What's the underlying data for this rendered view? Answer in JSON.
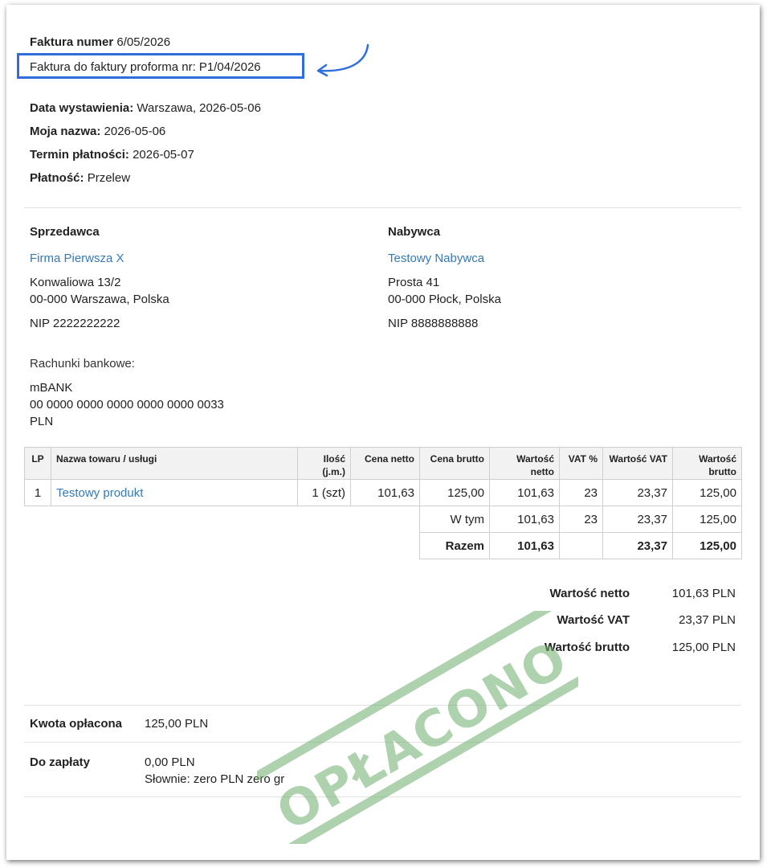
{
  "invoice": {
    "number_label": "Faktura numer",
    "number_value": "6/05/2026",
    "proforma_ref": "Faktura do faktury proforma nr: P1/04/2026"
  },
  "meta": [
    {
      "label": "Data wystawienia:",
      "value": "Warszawa, 2026-05-06"
    },
    {
      "label": "Moja nazwa:",
      "value": "2026-05-06"
    },
    {
      "label": "Termin płatności:",
      "value": "2026-05-07"
    },
    {
      "label": "Płatność:",
      "value": "Przelew"
    }
  ],
  "seller": {
    "heading": "Sprzedawca",
    "name": "Firma Pierwsza X",
    "street": "Konwaliowa 13/2",
    "city": "00-000 Warszawa, Polska",
    "nip": "NIP 2222222222"
  },
  "buyer": {
    "heading": "Nabywca",
    "name": "Testowy Nabywca",
    "street": "Prosta 41",
    "city": "00-000 Płock, Polska",
    "nip": "NIP 8888888888"
  },
  "bank": {
    "heading": "Rachunki bankowe:",
    "name": "mBANK",
    "account": "00 0000 0000 0000 0000 0000 0033",
    "currency": "PLN"
  },
  "items_table": {
    "headers": [
      "LP",
      "Nazwa towaru / usługi",
      "Ilość (j.m.)",
      "Cena netto",
      "Cena brutto",
      "Wartość netto",
      "VAT %",
      "Wartość VAT",
      "Wartość brutto"
    ],
    "header_lines": {
      "qty": [
        "Ilość",
        "(j.m.)"
      ],
      "net_value": [
        "Wartość",
        "netto"
      ],
      "gross_value": [
        "Wartość",
        "brutto"
      ]
    },
    "rows": [
      {
        "lp": "1",
        "name": "Testowy produkt",
        "qty": "1 (szt)",
        "net_price": "101,63",
        "gross_price": "125,00",
        "net_value": "101,63",
        "vat_rate": "23",
        "vat_value": "23,37",
        "gross_value": "125,00"
      }
    ],
    "subtotal": {
      "label": "W tym",
      "net_value": "101,63",
      "vat_rate": "23",
      "vat_value": "23,37",
      "gross_value": "125,00"
    },
    "total": {
      "label": "Razem",
      "net_value": "101,63",
      "vat_rate": "",
      "vat_value": "23,37",
      "gross_value": "125,00"
    }
  },
  "summary": [
    {
      "label": "Wartość netto",
      "value": "101,63 PLN"
    },
    {
      "label": "Wartość VAT",
      "value": "23,37 PLN"
    },
    {
      "label": "Wartość brutto",
      "value": "125,00 PLN"
    }
  ],
  "payment": {
    "paid_label": "Kwota opłacona",
    "paid_value": "125,00 PLN",
    "due_label": "Do zapłaty",
    "due_value": "0,00 PLN",
    "in_words": "Słownie: zero PLN zero gr"
  },
  "stamp_text": "OPŁACONO",
  "colors": {
    "link": "#3579b8",
    "highlight": "#2f6fdc",
    "stamp": "#6fae6c"
  }
}
